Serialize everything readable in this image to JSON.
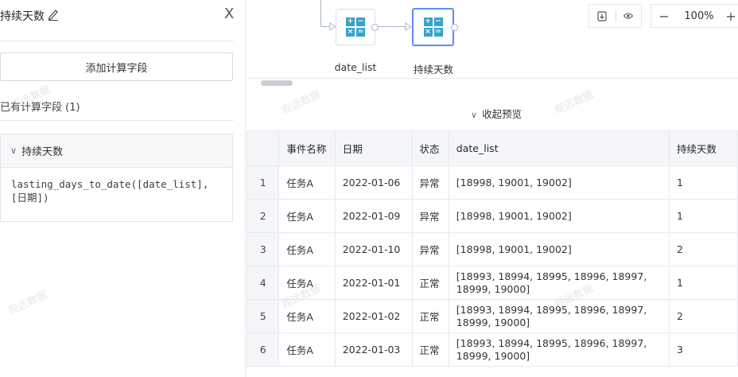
{
  "left_panel": {
    "title": "持续天数",
    "close_glyph": "X",
    "add_button_label": "添加计算字段",
    "existing_fields_label": "已有计算字段 (1)",
    "fields": [
      {
        "name": "持续天数",
        "formula": "lasting_days_to_date([date_list],[日期])"
      }
    ]
  },
  "canvas": {
    "nodes": [
      {
        "label": "date_list",
        "icon": "calculator-icon",
        "selected": false
      },
      {
        "label": "持续天数",
        "icon": "calculator-icon",
        "selected": true
      }
    ],
    "calc_icon_glyphs": [
      "+",
      "−",
      "×",
      "="
    ],
    "toolbar": {
      "zoom": "100%",
      "zoom_out": "−",
      "zoom_in": "+"
    }
  },
  "preview": {
    "collapse_label": "收起预览",
    "columns": [
      "",
      "事件名称",
      "日期",
      "状态",
      "date_list",
      "持续天数"
    ],
    "rows": [
      [
        "1",
        "任务A",
        "2022-01-06",
        "异常",
        "[18998, 19001, 19002]",
        "1"
      ],
      [
        "2",
        "任务A",
        "2022-01-09",
        "异常",
        "[18998, 19001, 19002]",
        "1"
      ],
      [
        "3",
        "任务A",
        "2022-01-10",
        "异常",
        "[18998, 19001, 19002]",
        "2"
      ],
      [
        "4",
        "任务A",
        "2022-01-01",
        "正常",
        "[18993, 18994, 18995, 18996, 18997, 18999, 19000]",
        "1"
      ],
      [
        "5",
        "任务A",
        "2022-01-02",
        "正常",
        "[18993, 18994, 18995, 18996, 18997, 18999, 19000]",
        "2"
      ],
      [
        "6",
        "任务A",
        "2022-01-03",
        "正常",
        "[18993, 18994, 18995, 18996, 18997, 18999, 19000]",
        "3"
      ]
    ]
  },
  "watermark": "观远数据",
  "colors": {
    "accent": "#5b8cf6",
    "calc_icon": "#3aa3c9",
    "header_bg": "#f4f6f9",
    "border": "#e6e9ee"
  }
}
